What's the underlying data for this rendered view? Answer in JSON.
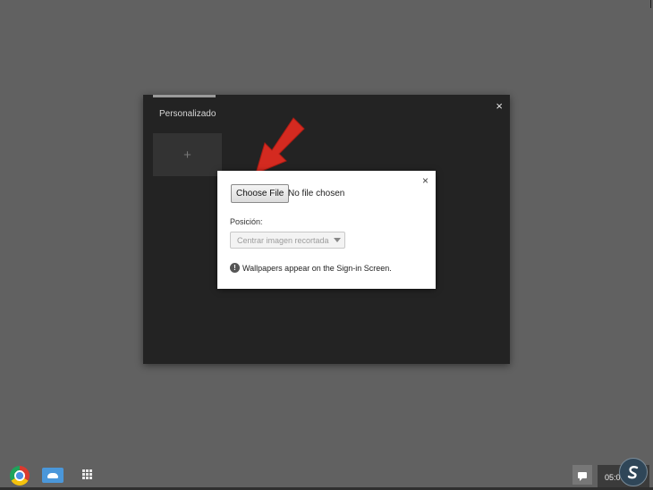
{
  "picker": {
    "tab_label": "Personalizado",
    "close_symbol": "×",
    "add_symbol": "+"
  },
  "dialog": {
    "close_symbol": "×",
    "choose_file_label": "Choose File",
    "file_status": "No file chosen",
    "position_label": "Posición:",
    "position_selected": "Centrar imagen recortada",
    "info_icon": "!",
    "info_text": "Wallpapers appear on the Sign-in Screen."
  },
  "annotation": {
    "arrow_color": "#d42a20"
  },
  "shelf": {
    "clock": "05:06",
    "icons": [
      "chrome-icon",
      "files-cloud-icon",
      "app-launcher-icon",
      "notifications-icon",
      "solvetic-logo-icon"
    ]
  },
  "colors": {
    "desktop": "#616161",
    "picker_bg": "#232323",
    "dialog_bg": "#ffffff"
  }
}
